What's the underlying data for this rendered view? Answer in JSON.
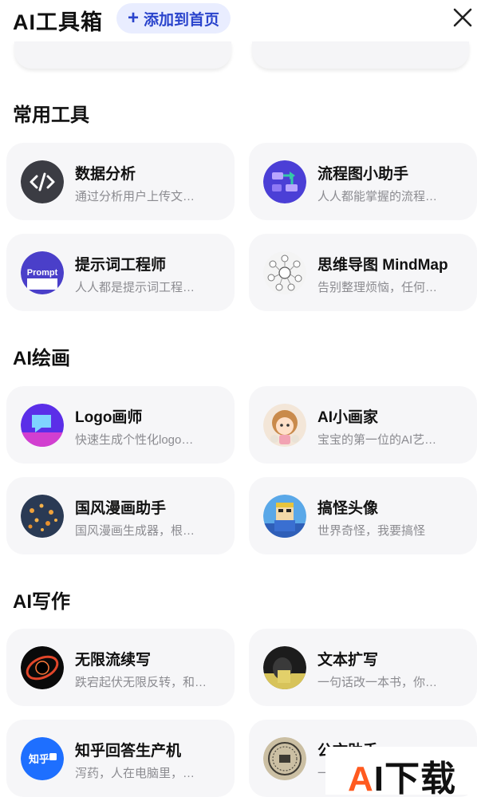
{
  "header": {
    "title": "AI工具箱",
    "add_label": "添加到首页"
  },
  "sections": [
    {
      "title": "常用工具",
      "items": [
        {
          "name": "数据分析",
          "desc": "通过分析用户上传文…"
        },
        {
          "name": "流程图小助手",
          "desc": "人人都能掌握的流程…"
        },
        {
          "name": "提示词工程师",
          "desc": "人人都是提示词工程…"
        },
        {
          "name": "思维导图 MindMap",
          "desc": "告别整理烦恼，任何…"
        }
      ]
    },
    {
      "title": "AI绘画",
      "items": [
        {
          "name": "Logo画师",
          "desc": "快速生成个性化logo…"
        },
        {
          "name": "AI小画家",
          "desc": "宝宝的第一位的AI艺…"
        },
        {
          "name": "国风漫画助手",
          "desc": "国风漫画生成器，根…"
        },
        {
          "name": "搞怪头像",
          "desc": "世界奇怪，我要搞怪"
        }
      ]
    },
    {
      "title": "AI写作",
      "items": [
        {
          "name": "无限流续写",
          "desc": "跌宕起伏无限反转，和…"
        },
        {
          "name": "文本扩写",
          "desc": "一句话改一本书，你…"
        },
        {
          "name": "知乎回答生产机",
          "desc": "泻药，人在电脑里，…"
        },
        {
          "name": "公文助手",
          "desc": "一…"
        }
      ]
    }
  ],
  "icon_labels": {
    "prompt": "Prompt",
    "zhihu": "知乎"
  },
  "watermark": {
    "a": "A",
    "rest": "I下载"
  },
  "colors": {
    "accent": "#2a44cc",
    "accent_bg": "#e9edff",
    "card_bg": "#f6f6f8",
    "desc": "#8b8b90"
  }
}
